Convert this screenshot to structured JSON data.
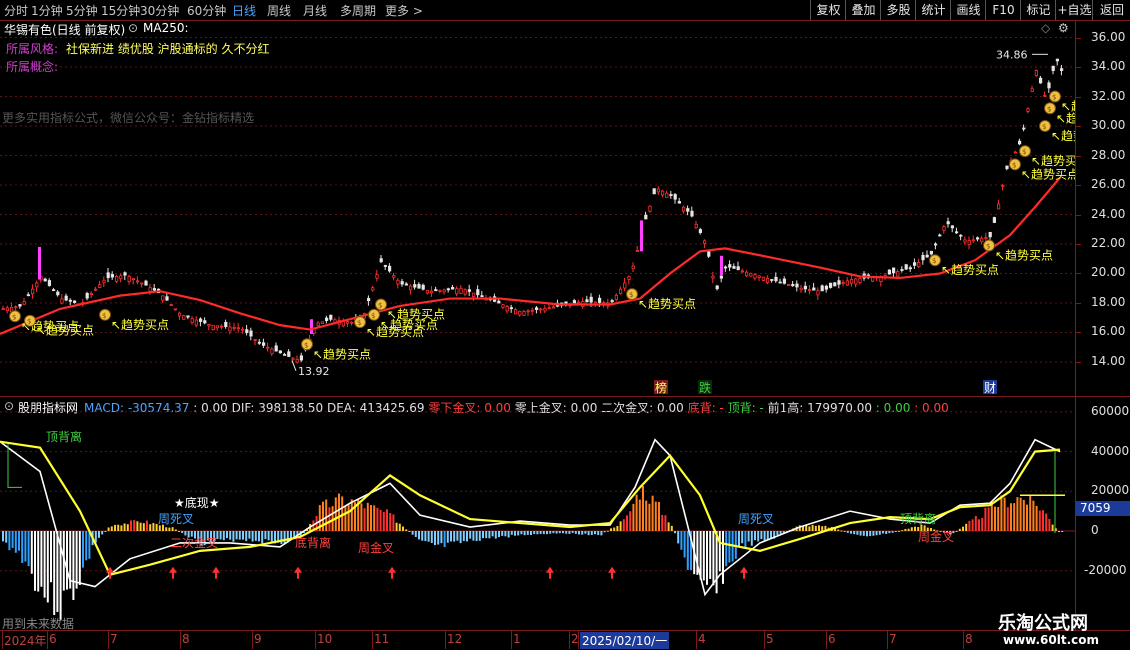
{
  "toolbar": {
    "periods": [
      "分时",
      "1分钟",
      "5分钟",
      "15分钟",
      "30分钟",
      "60分钟",
      "日线",
      "周线",
      "月线",
      "多周期",
      "更多 >"
    ],
    "active_period": "日线",
    "right_buttons": [
      "复权",
      "叠加",
      "多股",
      "统计",
      "画线",
      "F10",
      "标记",
      "+自选",
      "返回"
    ]
  },
  "main_chart": {
    "stock_title": "华锡有色(日线 前复权)",
    "ma_label": "MA250:",
    "style_label": "所属风格:",
    "style_value": "社保新进 绩优股 沪股通标的 久不分红",
    "concept_label": "所属概念:",
    "watermark": "更多实用指标公式，微信公众号：金钻指标精选",
    "high_value": "34.86",
    "low_value": "13.92",
    "signal_text": "趋势买点",
    "event_tags": [
      "榜",
      "跌",
      "财"
    ],
    "price_axis": [
      "36.00",
      "34.00",
      "32.00",
      "30.00",
      "28.00",
      "26.00",
      "24.00",
      "22.00",
      "20.00",
      "18.00",
      "16.00",
      "14.00"
    ],
    "colors": {
      "ma_line": "#ff2a2a",
      "up": "#ff3030",
      "down": "#e6e6e6",
      "signal": "#ffff40",
      "title": "#ffffff"
    }
  },
  "sub_chart": {
    "indicator_name": "股朋指标网",
    "macd_label": "MACD: -30574.37",
    "fields": [
      {
        "text": "MACD: -30574.37",
        "color": "#4ea3ff"
      },
      {
        "text": ": 0.00",
        "color": "#e0e0e0"
      },
      {
        "text": "DIF: 398138.50",
        "color": "#e0e0e0"
      },
      {
        "text": "DEA: 413425.69",
        "color": "#e0e0e0"
      },
      {
        "text": "零下金叉: 0.00",
        "color": "#ff4040"
      },
      {
        "text": "零上金叉: 0.00",
        "color": "#e0e0e0"
      },
      {
        "text": "二次金叉: 0.00",
        "color": "#e0e0e0"
      },
      {
        "text": "底背: -",
        "color": "#ff4040"
      },
      {
        "text": "顶背: -",
        "color": "#40d040"
      },
      {
        "text": "前1高: 179970.00",
        "color": "#e0e0e0"
      },
      {
        "text": ": 0.00",
        "color": "#40d040"
      },
      {
        "text": ": 0.00",
        "color": "#ff4040"
      }
    ],
    "labels": {
      "top_divergence": "顶背离",
      "bottom_show": "★底现★",
      "dead_cross": "周死叉",
      "golden_cross": "周金叉",
      "second_gold": "二次金叉",
      "low_div": "底背离",
      "future_data": "用到未来数据"
    },
    "axis": [
      "60000",
      "40000",
      "20000",
      "0",
      "-20000"
    ],
    "current_value": "7059"
  },
  "date_axis": [
    "2024年",
    "6",
    "7",
    "8",
    "9",
    "10",
    "11",
    "12",
    "1",
    "2",
    "2025/02/10/一",
    "4",
    "5",
    "6",
    "7",
    "8"
  ],
  "watermark_brand": {
    "name": "乐淘公式网",
    "url": "www.60lt.com"
  }
}
